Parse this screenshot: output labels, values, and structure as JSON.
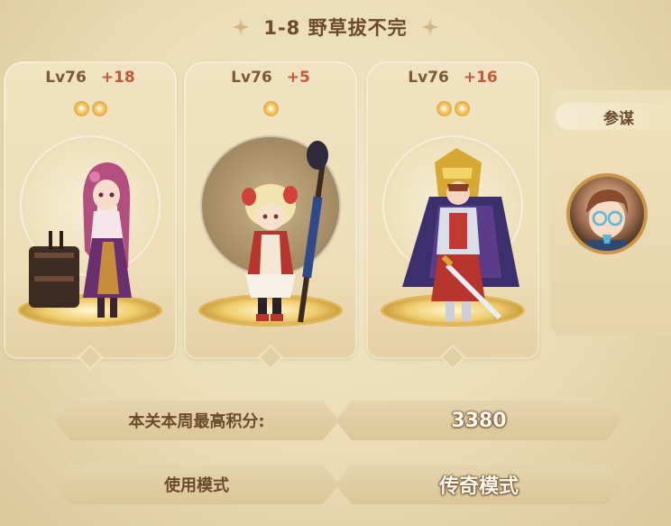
{
  "title": "1-8 野草拔不完",
  "heroes": [
    {
      "level": "Lv76",
      "bonus": "+18",
      "stars": 2
    },
    {
      "level": "Lv76",
      "bonus": "+5",
      "stars": 1
    },
    {
      "level": "Lv76",
      "bonus": "+16",
      "stars": 2
    }
  ],
  "advisor": {
    "label": "参谋"
  },
  "score_row": {
    "label": "本关本周最高积分:",
    "value": "3380"
  },
  "mode_row": {
    "label": "使用模式",
    "value": "传奇模式"
  }
}
